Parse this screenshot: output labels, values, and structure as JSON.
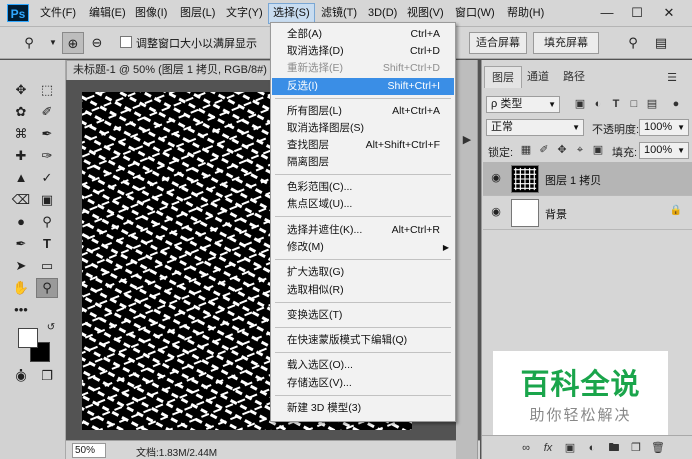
{
  "app": {
    "logo": "Ps"
  },
  "menubar": {
    "items": [
      "文件(F)",
      "编辑(E)",
      "图像(I)",
      "图层(L)",
      "文字(Y)",
      "选择(S)",
      "滤镜(T)",
      "3D(D)",
      "视图(V)",
      "窗口(W)",
      "帮助(H)"
    ],
    "active_index": 5,
    "window_controls": [
      "minimize-icon",
      "maximize-icon",
      "close-icon"
    ]
  },
  "options_bar": {
    "resize_window_label": "调整窗口大小以满屏显示",
    "fit_screen": "适合屏幕",
    "fill_screen": "填充屏幕"
  },
  "document": {
    "tab_title": "未标题-1 @ 50% (图层 1 拷贝, RGB/8#) *",
    "zoom": "50%",
    "doc_info": "文档:1.83M/2.44M"
  },
  "select_menu": {
    "items": [
      {
        "label": "全部(A)",
        "shortcut": "Ctrl+A",
        "state": "normal"
      },
      {
        "label": "取消选择(D)",
        "shortcut": "Ctrl+D",
        "state": "normal"
      },
      {
        "label": "重新选择(E)",
        "shortcut": "Shift+Ctrl+D",
        "state": "disabled"
      },
      {
        "label": "反选(I)",
        "shortcut": "Shift+Ctrl+I",
        "state": "highlight"
      },
      {
        "label": "所有图层(L)",
        "shortcut": "Alt+Ctrl+A",
        "state": "normal"
      },
      {
        "label": "取消选择图层(S)",
        "shortcut": "",
        "state": "normal"
      },
      {
        "label": "查找图层",
        "shortcut": "Alt+Shift+Ctrl+F",
        "state": "normal"
      },
      {
        "label": "隔离图层",
        "shortcut": "",
        "state": "normal"
      },
      {
        "label": "色彩范围(C)...",
        "shortcut": "",
        "state": "normal"
      },
      {
        "label": "焦点区域(U)...",
        "shortcut": "",
        "state": "normal"
      },
      {
        "label": "选择并遮住(K)...",
        "shortcut": "Alt+Ctrl+R",
        "state": "normal"
      },
      {
        "label": "修改(M)",
        "shortcut": "",
        "state": "submenu"
      },
      {
        "label": "扩大选取(G)",
        "shortcut": "",
        "state": "normal"
      },
      {
        "label": "选取相似(R)",
        "shortcut": "",
        "state": "normal"
      },
      {
        "label": "变换选区(T)",
        "shortcut": "",
        "state": "normal"
      },
      {
        "label": "在快速蒙版模式下编辑(Q)",
        "shortcut": "",
        "state": "normal"
      },
      {
        "label": "载入选区(O)...",
        "shortcut": "",
        "state": "normal"
      },
      {
        "label": "存储选区(V)...",
        "shortcut": "",
        "state": "normal"
      },
      {
        "label": "新建 3D 模型(3)",
        "shortcut": "",
        "state": "normal"
      }
    ]
  },
  "layers_panel": {
    "tabs": [
      "图层",
      "通道",
      "路径"
    ],
    "kind_filter": "ρ 类型",
    "blend_mode": "正常",
    "opacity_label": "不透明度:",
    "opacity_value": "100%",
    "lock_label": "锁定:",
    "fill_label": "填充:",
    "fill_value": "100%",
    "layers": [
      {
        "name": "图层 1 拷贝",
        "selected": true,
        "locked": false
      },
      {
        "name": "背景",
        "selected": false,
        "locked": true
      }
    ]
  },
  "watermark": {
    "main": "百科全说",
    "sub": "助你轻松解决"
  },
  "colors": {
    "menu_highlight": "#3a8ee6",
    "watermark_green": "#1aa54b"
  }
}
